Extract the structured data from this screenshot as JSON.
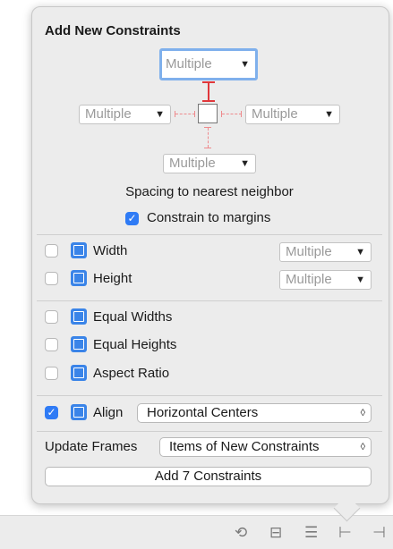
{
  "popover": {
    "title": "Add New Constraints",
    "spacing": {
      "top": "Multiple",
      "left": "Multiple",
      "right": "Multiple",
      "bottom": "Multiple",
      "caption": "Spacing to nearest neighbor"
    },
    "constrain_margins": {
      "label": "Constrain to margins",
      "checked": true
    },
    "size": [
      {
        "label": "Width",
        "value": "Multiple",
        "checked": false,
        "icon": "width-icon"
      },
      {
        "label": "Height",
        "value": "Multiple",
        "checked": false,
        "icon": "height-icon"
      }
    ],
    "equal": [
      {
        "label": "Equal Widths",
        "checked": false,
        "icon": "equal-widths-icon"
      },
      {
        "label": "Equal Heights",
        "checked": false,
        "icon": "equal-heights-icon"
      },
      {
        "label": "Aspect Ratio",
        "checked": false,
        "icon": "aspect-ratio-icon"
      }
    ],
    "align": {
      "label": "Align",
      "value": "Horizontal Centers",
      "checked": true,
      "icon": "align-icon"
    },
    "update_frames": {
      "label": "Update Frames",
      "value": "Items of New Constraints"
    },
    "add_button": "Add 7 Constraints"
  },
  "toolbar": {
    "icons": [
      "update-frames-icon",
      "embed-in-stack-icon",
      "align-icon",
      "add-constraints-icon",
      "resolve-issues-icon"
    ]
  },
  "colors": {
    "accent": "#2f7bf5",
    "constraint_red": "#e0373b",
    "focus_ring": "#7fb0ec"
  },
  "glyphs": {
    "caret": "▼",
    "updown": "◊",
    "check": "✓"
  }
}
